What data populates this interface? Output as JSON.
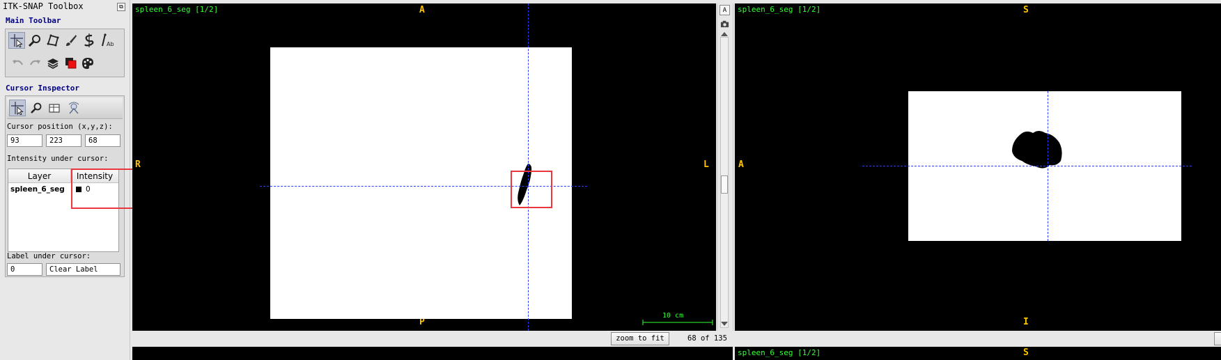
{
  "toolbox": {
    "title": "ITK-SNAP Toolbox",
    "main_toolbar_label": "Main Toolbar",
    "main_tools": [
      "crosshair-tool",
      "zoom-tool",
      "polygon-tool",
      "paintbrush-tool",
      "snake-tool",
      "annotation-tool"
    ],
    "secondary_tools": [
      "undo",
      "redo",
      "layer-inspector",
      "label-editor",
      "color-map"
    ],
    "cursor_inspector_label": "Cursor Inspector",
    "inspector_tabs": [
      "cursor-tab",
      "zoom-tab",
      "table-tab",
      "network-tab"
    ],
    "cursor_position_label": "Cursor position (x,y,z):",
    "cursor_x": "93",
    "cursor_y": "223",
    "cursor_z": "68",
    "intensity_label": "Intensity under cursor:",
    "table_headers": {
      "layer": "Layer",
      "intensity": "Intensity"
    },
    "table_rows": [
      {
        "layer": "spleen_6_seg",
        "intensity": "0"
      }
    ],
    "label_under_cursor_label": "Label under cursor:",
    "label_value": "0",
    "label_name": "Clear Label"
  },
  "axial_view": {
    "title": "spleen_6_seg [1/2]",
    "top": "A",
    "bottom": "P",
    "left": "R",
    "right": "L",
    "scale_label": "10 cm",
    "zoom_button": "zoom to fit",
    "slice_counter": "68 of 135"
  },
  "coronal_view": {
    "title": "spleen_6_seg [1/2]",
    "top": "S",
    "bottom": "I",
    "left": "A"
  },
  "lower_left_view": {},
  "lower_right_view": {
    "title": "spleen_6_seg [1/2]",
    "top": "S"
  },
  "colors": {
    "section_label": "#00008b",
    "overlay_text": "#33ff33",
    "orientation": "#ffc400",
    "crosshair": "#2a3dff",
    "highlight_box": "#e8383d"
  }
}
